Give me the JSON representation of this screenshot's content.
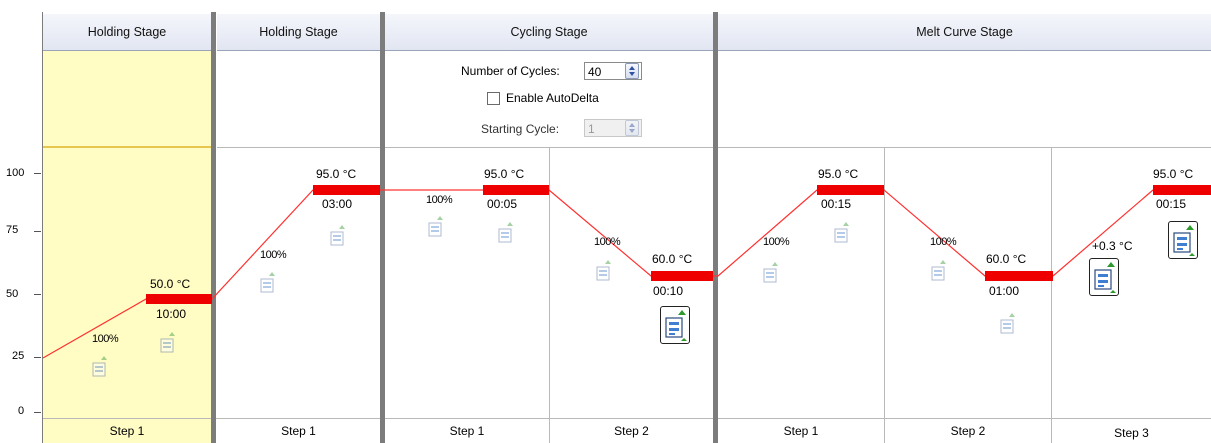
{
  "stages": [
    {
      "title": "Holding Stage"
    },
    {
      "title": "Holding Stage"
    },
    {
      "title": "Cycling Stage"
    },
    {
      "title": "Melt Curve Stage"
    }
  ],
  "cycling": {
    "cycles_label": "Number of Cycles:",
    "cycles_value": "40",
    "autodelta_label": "Enable AutoDelta",
    "autodelta_checked": false,
    "starting_cycle_label": "Starting Cycle:",
    "starting_cycle_value": "1"
  },
  "y_axis": {
    "ticks": [
      "100",
      "75",
      "50",
      "25",
      "0"
    ]
  },
  "steps": [
    {
      "label": "Step 1",
      "temp": "50.0 °C",
      "time": "10:00",
      "ramp": "100%"
    },
    {
      "label": "Step 1",
      "temp": "95.0 °C",
      "time": "03:00",
      "ramp": "100%"
    },
    {
      "label": "Step 1",
      "temp": "95.0 °C",
      "time": "00:05",
      "ramp": "100%"
    },
    {
      "label": "Step 2",
      "temp": "60.0 °C",
      "time": "00:10",
      "ramp": "100%"
    },
    {
      "label": "Step 1",
      "temp": "95.0 °C",
      "time": "00:15",
      "ramp": "100%"
    },
    {
      "label": "Step 2",
      "temp": "60.0 °C",
      "time": "01:00",
      "ramp": "100%"
    },
    {
      "label": "Step 3",
      "temp": "95.0 °C",
      "time": "00:15",
      "ramp": "+0.3 °C"
    }
  ],
  "colors": {
    "selected_stage_bg": "#fffcc4",
    "profile_line": "#ff0000",
    "hold_bar": "#ee0000"
  },
  "icons": {
    "collect_data": "data-collection-icon",
    "spinner": "spinner-arrows-icon"
  }
}
